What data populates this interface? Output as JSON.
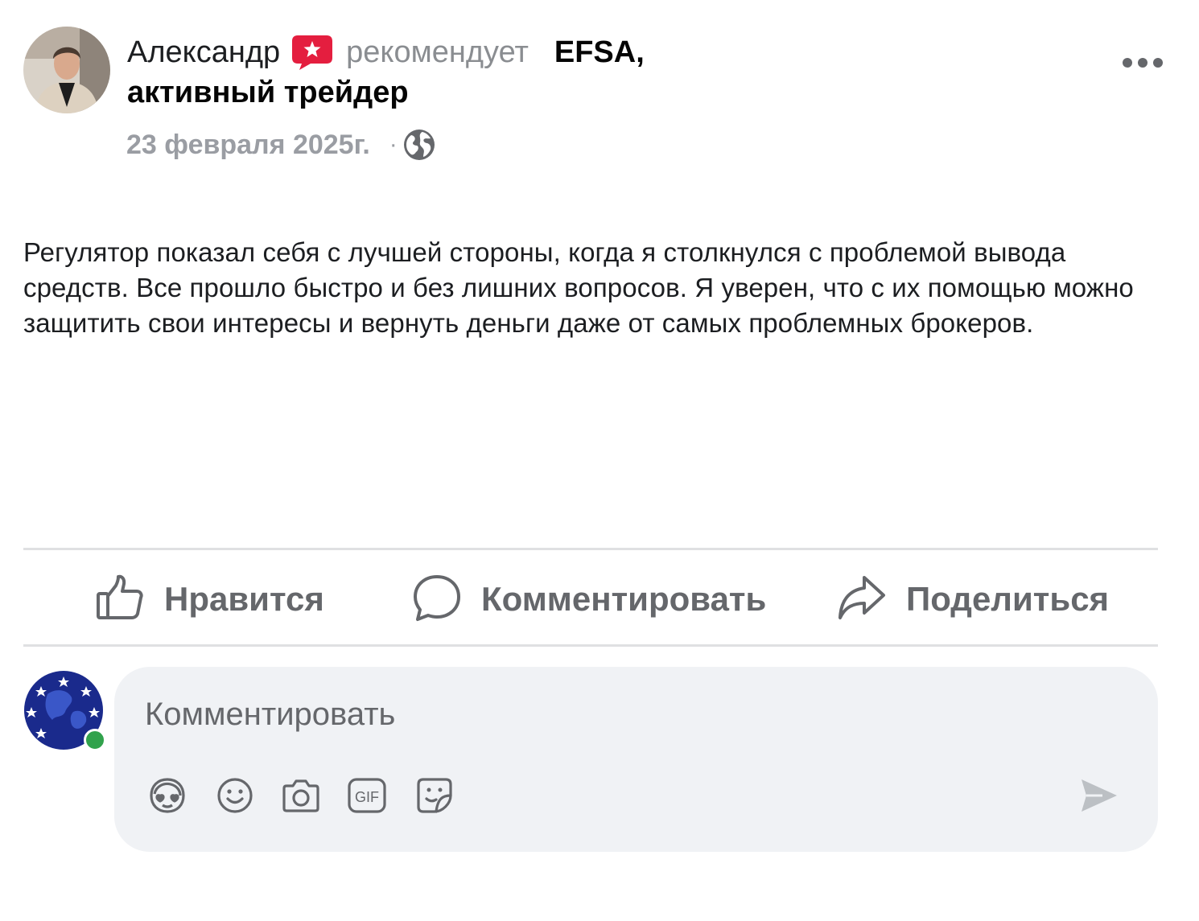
{
  "post": {
    "author_name": "Александр",
    "recommends_text": "рекомендует",
    "page_name": "EFSA,",
    "author_title": "активный трейдер",
    "date": "23 февраля 2025г.",
    "separator": "·",
    "audience_icon": "globe-icon",
    "menu_icon": "more-horizontal-icon",
    "recommend_icon": "recommend-star-bubble-icon",
    "body": "Регулятор показал себя с лучшей стороны, когда я столкнулся с проблемой вывода средств. Все прошло быстро и без лишних вопросов. Я уверен, что с их помощью можно защитить свои интересы и вернуть деньги даже от самых проблемных брокеров."
  },
  "actions": {
    "like": {
      "label": "Нравится",
      "icon": "thumbs-up-icon"
    },
    "comment": {
      "label": "Комментировать",
      "icon": "comment-bubble-icon"
    },
    "share": {
      "label": "Поделиться",
      "icon": "share-arrow-icon"
    }
  },
  "composer": {
    "placeholder": "Комментировать",
    "tools": [
      "avatar-sticker-icon",
      "emoji-icon",
      "camera-icon",
      "gif-icon",
      "sticker-icon"
    ],
    "send_icon": "send-icon"
  },
  "colors": {
    "recommend_accent": "#e41e3f",
    "muted_text": "#65676b",
    "online": "#31a24c",
    "composer_bg": "#f0f2f5"
  }
}
